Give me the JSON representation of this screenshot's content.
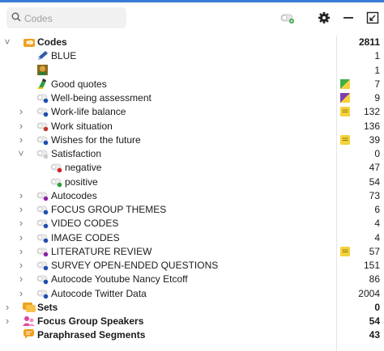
{
  "search": {
    "placeholder": "Codes"
  },
  "toolbar": {
    "toggle_icon": "toggle-switch-icon",
    "settings_icon": "gear-icon",
    "minimize_icon": "minimize-icon",
    "expand_icon": "expand-icon"
  },
  "colors": {
    "accent": "#3a7bd5",
    "memo_yellow": "#f5d23c",
    "codes_orange": "#f0a020"
  },
  "rows": [
    {
      "label": "Codes",
      "count": "2811",
      "bold": true,
      "level": 0,
      "chevron": "down",
      "icon": "codes-folder-icon"
    },
    {
      "label": "BLUE",
      "count": "1",
      "level": 1,
      "icon": "pencil-icon"
    },
    {
      "label": "",
      "count": "1",
      "level": 1,
      "icon": "image-icon"
    },
    {
      "label": "Good quotes",
      "count": "7",
      "level": 1,
      "icon": "highlighter-icon",
      "memo": "green"
    },
    {
      "label": "Well-being assessment",
      "count": "9",
      "level": 1,
      "icon": "code-toggle-icon",
      "dot": "#1f4fb0",
      "memo": "purple"
    },
    {
      "label": "Work-life balance",
      "count": "132",
      "level": 1,
      "chevron": "right",
      "icon": "code-toggle-icon",
      "dot": "#1f4fb0",
      "memo": "yellow"
    },
    {
      "label": "Work situation",
      "count": "136",
      "level": 1,
      "chevron": "right",
      "icon": "code-toggle-icon",
      "dot": "#c0392b"
    },
    {
      "label": "Wishes for the future",
      "count": "39",
      "level": 1,
      "chevron": "right",
      "icon": "code-toggle-icon",
      "dot": "#1f4fb0",
      "memo": "yellow"
    },
    {
      "label": "Satisfaction",
      "count": "0",
      "level": 1,
      "chevron": "down",
      "icon": "code-toggle-icon",
      "dot": "#cccccc"
    },
    {
      "label": "negative",
      "count": "47",
      "level": 2,
      "icon": "code-toggle-icon",
      "dot": "#d62020"
    },
    {
      "label": "positive",
      "count": "54",
      "level": 2,
      "icon": "code-toggle-icon",
      "dot": "#2e9e3e"
    },
    {
      "label": "Autocodes",
      "count": "73",
      "level": 1,
      "chevron": "right",
      "icon": "code-toggle-icon",
      "dot": "#8e24aa"
    },
    {
      "label": "FOCUS GROUP THEMES",
      "count": "6",
      "level": 1,
      "chevron": "right",
      "icon": "code-toggle-icon",
      "dot": "#1f4fb0"
    },
    {
      "label": "VIDEO CODES",
      "count": "4",
      "level": 1,
      "chevron": "right",
      "icon": "code-toggle-icon",
      "dot": "#1f4fb0"
    },
    {
      "label": "IMAGE CODES",
      "count": "4",
      "level": 1,
      "chevron": "right",
      "icon": "code-toggle-icon",
      "dot": "#1f4fb0"
    },
    {
      "label": "LITERATURE REVIEW",
      "count": "57",
      "level": 1,
      "chevron": "right",
      "icon": "code-toggle-icon",
      "dot": "#8e24aa",
      "memo": "yellow"
    },
    {
      "label": "SURVEY OPEN-ENDED QUESTIONS",
      "count": "151",
      "level": 1,
      "chevron": "right",
      "icon": "code-toggle-icon",
      "dot": "#1f4fb0"
    },
    {
      "label": "Autocode Youtube Nancy Etcoff",
      "count": "86",
      "level": 1,
      "chevron": "right",
      "icon": "code-toggle-icon",
      "dot": "#1f4fb0"
    },
    {
      "label": "Autocode Twitter Data",
      "count": "2004",
      "level": 1,
      "chevron": "right",
      "icon": "code-toggle-icon",
      "dot": "#1f4fb0"
    },
    {
      "label": "Sets",
      "count": "0",
      "bold": true,
      "level": 0,
      "chevron": "right",
      "icon": "sets-icon"
    },
    {
      "label": "Focus Group Speakers",
      "count": "54",
      "bold": true,
      "level": 0,
      "chevron": "right",
      "icon": "speakers-icon"
    },
    {
      "label": "Paraphrased Segments",
      "count": "43",
      "bold": true,
      "level": 0,
      "icon": "speech-bubble-icon"
    }
  ]
}
